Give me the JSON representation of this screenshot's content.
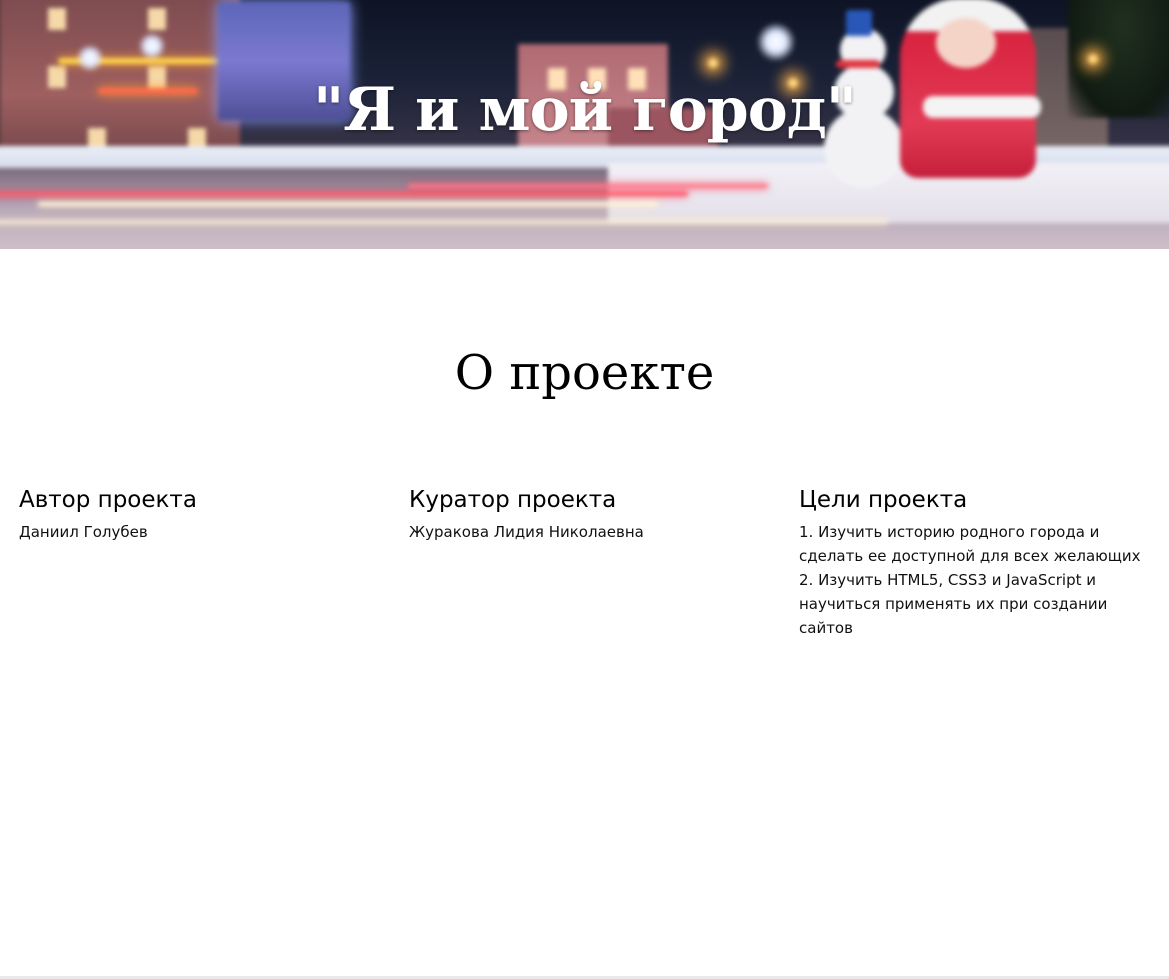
{
  "hero": {
    "title": "\"Я и мой город\"",
    "background": "night-city-christmas-photo"
  },
  "about": {
    "title": "О проекте",
    "columns": [
      {
        "heading": "Автор проекта",
        "text": "Даниил Голубев"
      },
      {
        "heading": "Куратор проекта",
        "text": "Журакова Лидия Николаевна"
      },
      {
        "heading": "Цели проекта",
        "goals": [
          "1. Изучить историю родного города и сделать ее доступной для всех желающих",
          "2. Изучить HTML5, CSS3 и JavaScript и научиться применять их при создании сайтов"
        ]
      }
    ]
  },
  "colors": {
    "background": "#ffffff",
    "text": "#000000",
    "hero_title": "#ffffff"
  }
}
